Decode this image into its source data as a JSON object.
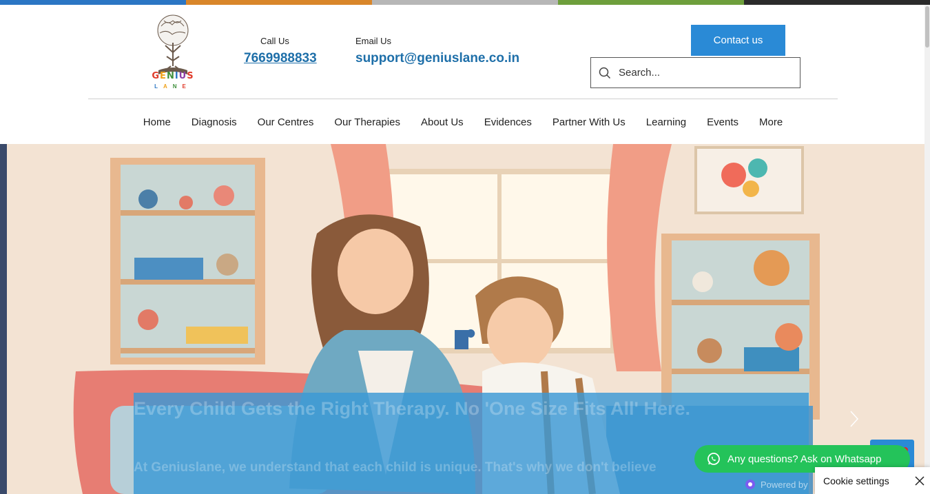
{
  "brand": {
    "name": "GENIUS",
    "tagline": "LANE",
    "colors": [
      "#2b76c4",
      "#d9862a",
      "#b7b7b7",
      "#6e9f3c"
    ]
  },
  "contact": {
    "call_label": "Call Us",
    "phone": "7669988833",
    "email_label": "Email Us",
    "email": "support@geniuslane.co.in"
  },
  "header": {
    "contact_button": "Contact us",
    "search_placeholder": "Search..."
  },
  "nav": {
    "items": [
      "Home",
      "Diagnosis",
      "Our Centres",
      "Our Therapies",
      "About Us",
      "Evidences",
      "Partner With Us",
      "Learning",
      "Events",
      "More"
    ]
  },
  "hero": {
    "headline": "Every Child Gets the Right Therapy. No 'One Size Fits All' Here.",
    "body": "At Geniuslane, we understand that each child is unique. That's why we don't believe"
  },
  "widgets": {
    "whatsapp_label": "Any questions? Ask on Whatsapp",
    "powered_by": "Powered by",
    "cookie_settings": "Cookie settings"
  },
  "icons": {
    "search": "search-icon",
    "whatsapp": "whatsapp-icon",
    "close": "close-icon",
    "next": "chevron-right-icon"
  },
  "accent": "#2a8ad6"
}
